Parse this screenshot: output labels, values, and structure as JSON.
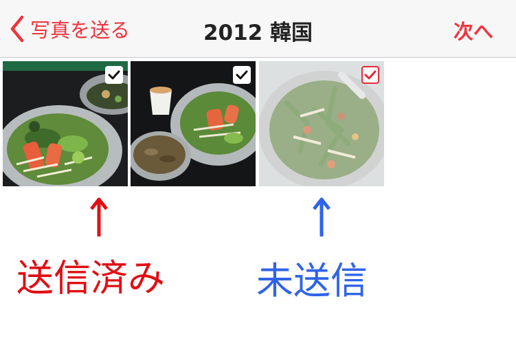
{
  "navbar": {
    "back_label": "写真を送る",
    "title": "2012 韓国",
    "next_label": "次へ"
  },
  "photos": [
    {
      "state": "sent",
      "checked": true
    },
    {
      "state": "sent",
      "checked": true
    },
    {
      "state": "unsent",
      "checked": true
    }
  ],
  "annotations": {
    "sent_label": "送信済み",
    "unsent_label": "未送信"
  },
  "colors": {
    "accent": "#f0333c",
    "sent_annotation": "#e00f14",
    "unsent_annotation": "#2f63e8"
  },
  "icons": {
    "back": "chevron-left-icon",
    "check": "checkmark-icon",
    "arrow": "up-arrow-icon"
  }
}
